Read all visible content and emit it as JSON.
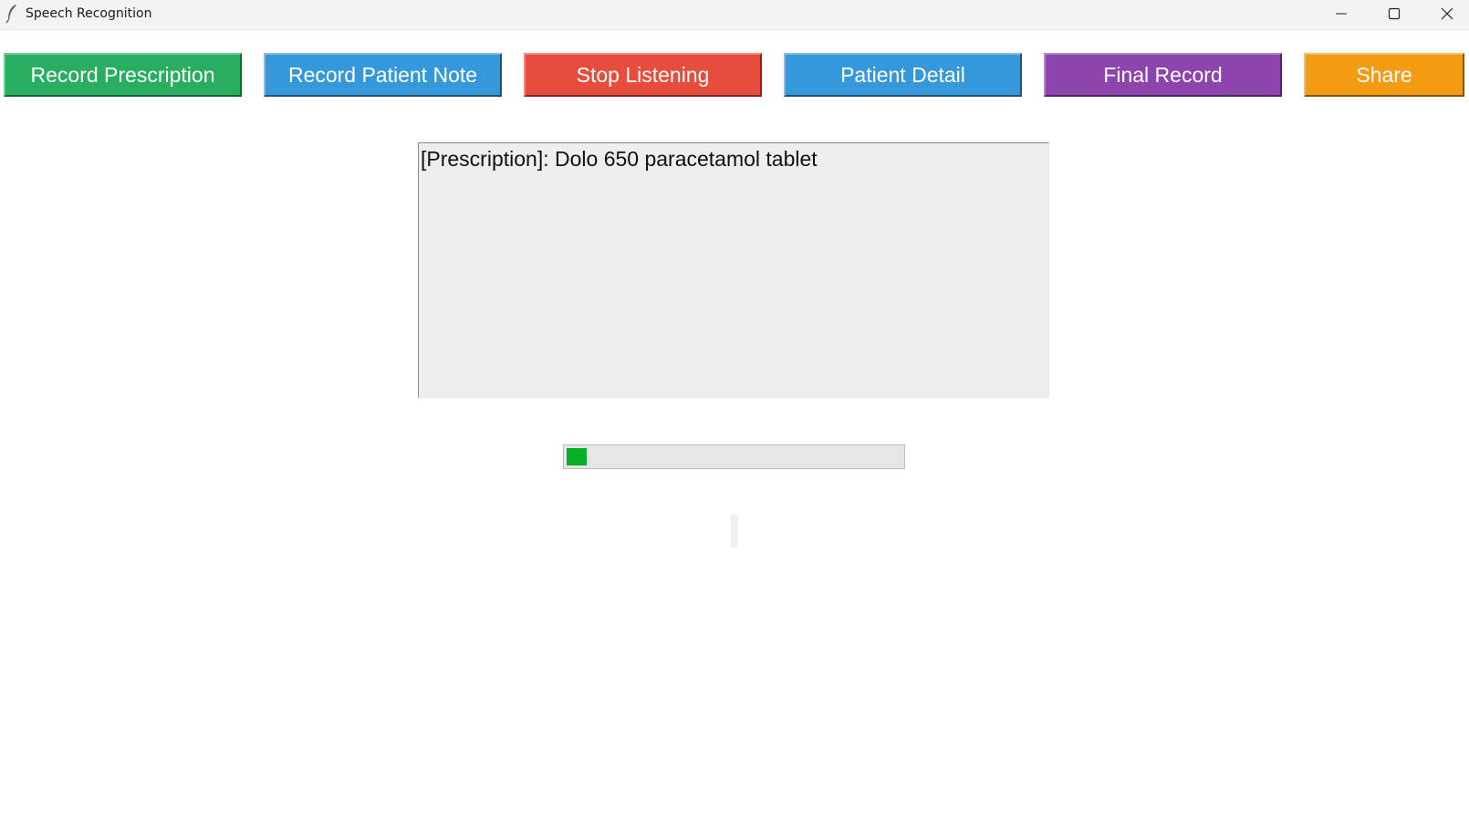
{
  "window": {
    "title": "Speech Recognition",
    "icon": "feather-icon",
    "controls": [
      "minimize-icon",
      "maximize-icon",
      "close-icon"
    ]
  },
  "toolbar": {
    "buttons": [
      {
        "label": "Record Prescription",
        "color": "#27ae60"
      },
      {
        "label": "Record Patient Note",
        "color": "#3498db"
      },
      {
        "label": "Stop Listening",
        "color": "#e74c3c"
      },
      {
        "label": "Patient Detail",
        "color": "#3498db"
      },
      {
        "label": "Final Record",
        "color": "#8e44ad"
      },
      {
        "label": "Share",
        "color": "#f39c12"
      }
    ]
  },
  "transcript": {
    "text": "[Prescription]: Dolo 650 paracetamol tablet"
  },
  "progress": {
    "fraction": 0.06,
    "color": "#06b025"
  },
  "status": {
    "text": ""
  }
}
